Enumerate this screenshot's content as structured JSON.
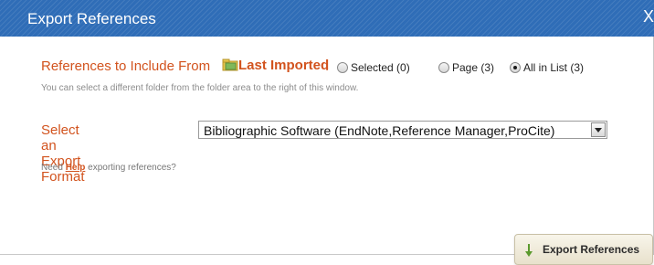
{
  "dialog": {
    "title": "Export References",
    "close_label": "X"
  },
  "refs": {
    "label": "References to Include From",
    "folder_name": "Last Imported",
    "colon": ":",
    "options": [
      {
        "label": "Selected (0)",
        "selected": false
      },
      {
        "label": "Page (3)",
        "selected": false
      },
      {
        "label": "All in List (3)",
        "selected": true
      }
    ],
    "hint": "You can select a different folder from the folder area to the right of this window."
  },
  "format": {
    "label": "Select an Export Format",
    "selected_value": "Bibliographic Software (EndNote,Reference Manager,ProCite)"
  },
  "help": {
    "prefix": "Need",
    "link": "Help",
    "suffix": "exporting references?"
  },
  "export_button": {
    "label": "Export References"
  },
  "colors": {
    "accent": "#d2531e",
    "titlebar": "#2f6db7"
  }
}
